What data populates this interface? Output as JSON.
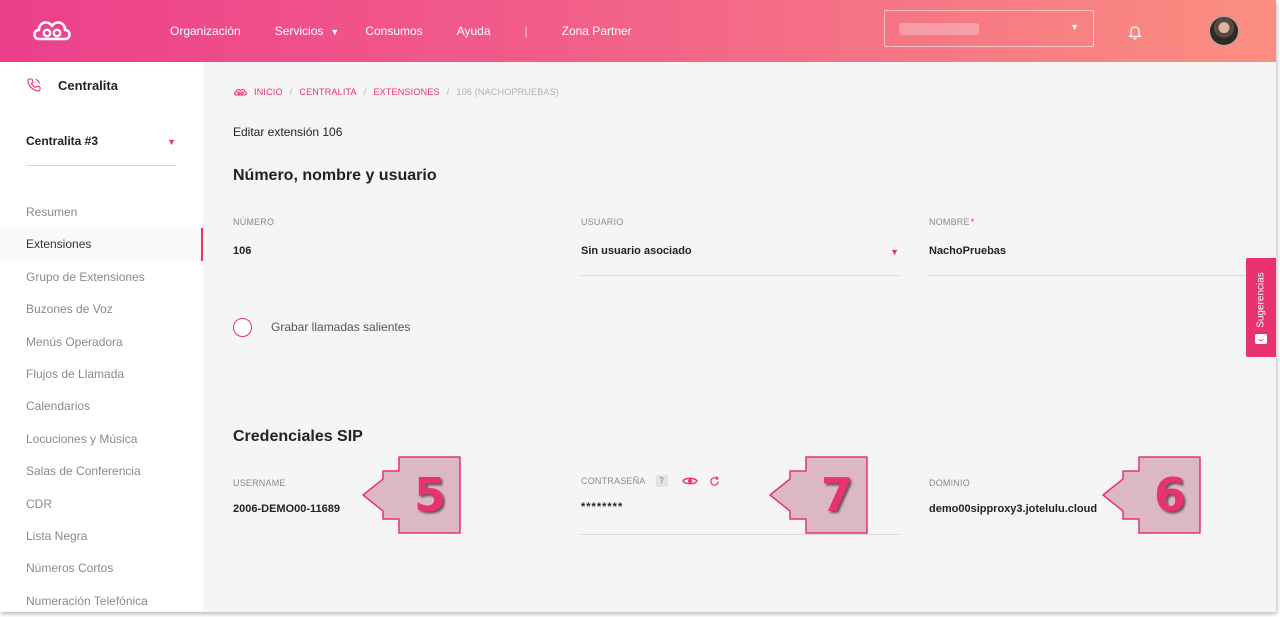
{
  "topbar": {
    "nav": [
      {
        "label": "Organización"
      },
      {
        "label": "Servicios"
      },
      {
        "label": "Consumos"
      },
      {
        "label": "Ayuda"
      },
      {
        "label": "|"
      },
      {
        "label": "Zona Partner"
      }
    ],
    "services_caret": "▼",
    "select_caret": "▼",
    "logo_icon": "cloud-logo-icon",
    "bell_icon": "bell-icon"
  },
  "sidebar": {
    "title": "Centralita",
    "title_icon": "phone-icon",
    "selector_value": "Centralita #3",
    "selector_caret": "▼",
    "items": [
      {
        "label": "Resumen"
      },
      {
        "label": "Extensiones"
      },
      {
        "label": "Grupo de Extensiones"
      },
      {
        "label": "Buzones de Voz"
      },
      {
        "label": "Menús Operadora"
      },
      {
        "label": "Flujos de Llamada"
      },
      {
        "label": "Calendarios"
      },
      {
        "label": "Locuciones y Música"
      },
      {
        "label": "Salas de Conferencia"
      },
      {
        "label": "CDR"
      },
      {
        "label": "Lista Negra"
      },
      {
        "label": "Números Cortos"
      },
      {
        "label": "Numeración Telefónica"
      }
    ],
    "active_item": "Extensiones"
  },
  "breadcrumb": {
    "items": [
      "INICIO",
      "CENTRALITA",
      "EXTENSIONES",
      "106 (NACHOPRUEBAS)"
    ],
    "separator": "/"
  },
  "main": {
    "edit_title": "Editar extensión 106",
    "section1_title": "Número, nombre y usuario",
    "numero_label": "NÚMERO",
    "numero_value": "106",
    "usuario_label": "USUARIO",
    "usuario_value": "Sin usuario asociado",
    "usuario_caret": "▼",
    "nombre_label": "NOMBRE",
    "nombre_required": "*",
    "nombre_value": "NachoPruebas",
    "record_label": "Grabar llamadas salientes",
    "section2_title": "Credenciales SIP",
    "username_label": "USERNAME",
    "username_value": "2006-DEMO00-11689",
    "password_label": "CONTRASEÑA",
    "password_help": "?",
    "password_value": "********",
    "dominio_label": "DOMINIO",
    "dominio_value": "demo00sipproxy3.jotelulu.cloud"
  },
  "callouts": {
    "username": "5",
    "password": "7",
    "dominio": "6"
  },
  "feedback_tab": {
    "label": "Sugerencias"
  },
  "colors": {
    "accent": "#e8336f",
    "header_gradient_start": "#ec3f8c",
    "header_gradient_end": "#fb8f80",
    "callout_fill": "#dcb8c4"
  }
}
